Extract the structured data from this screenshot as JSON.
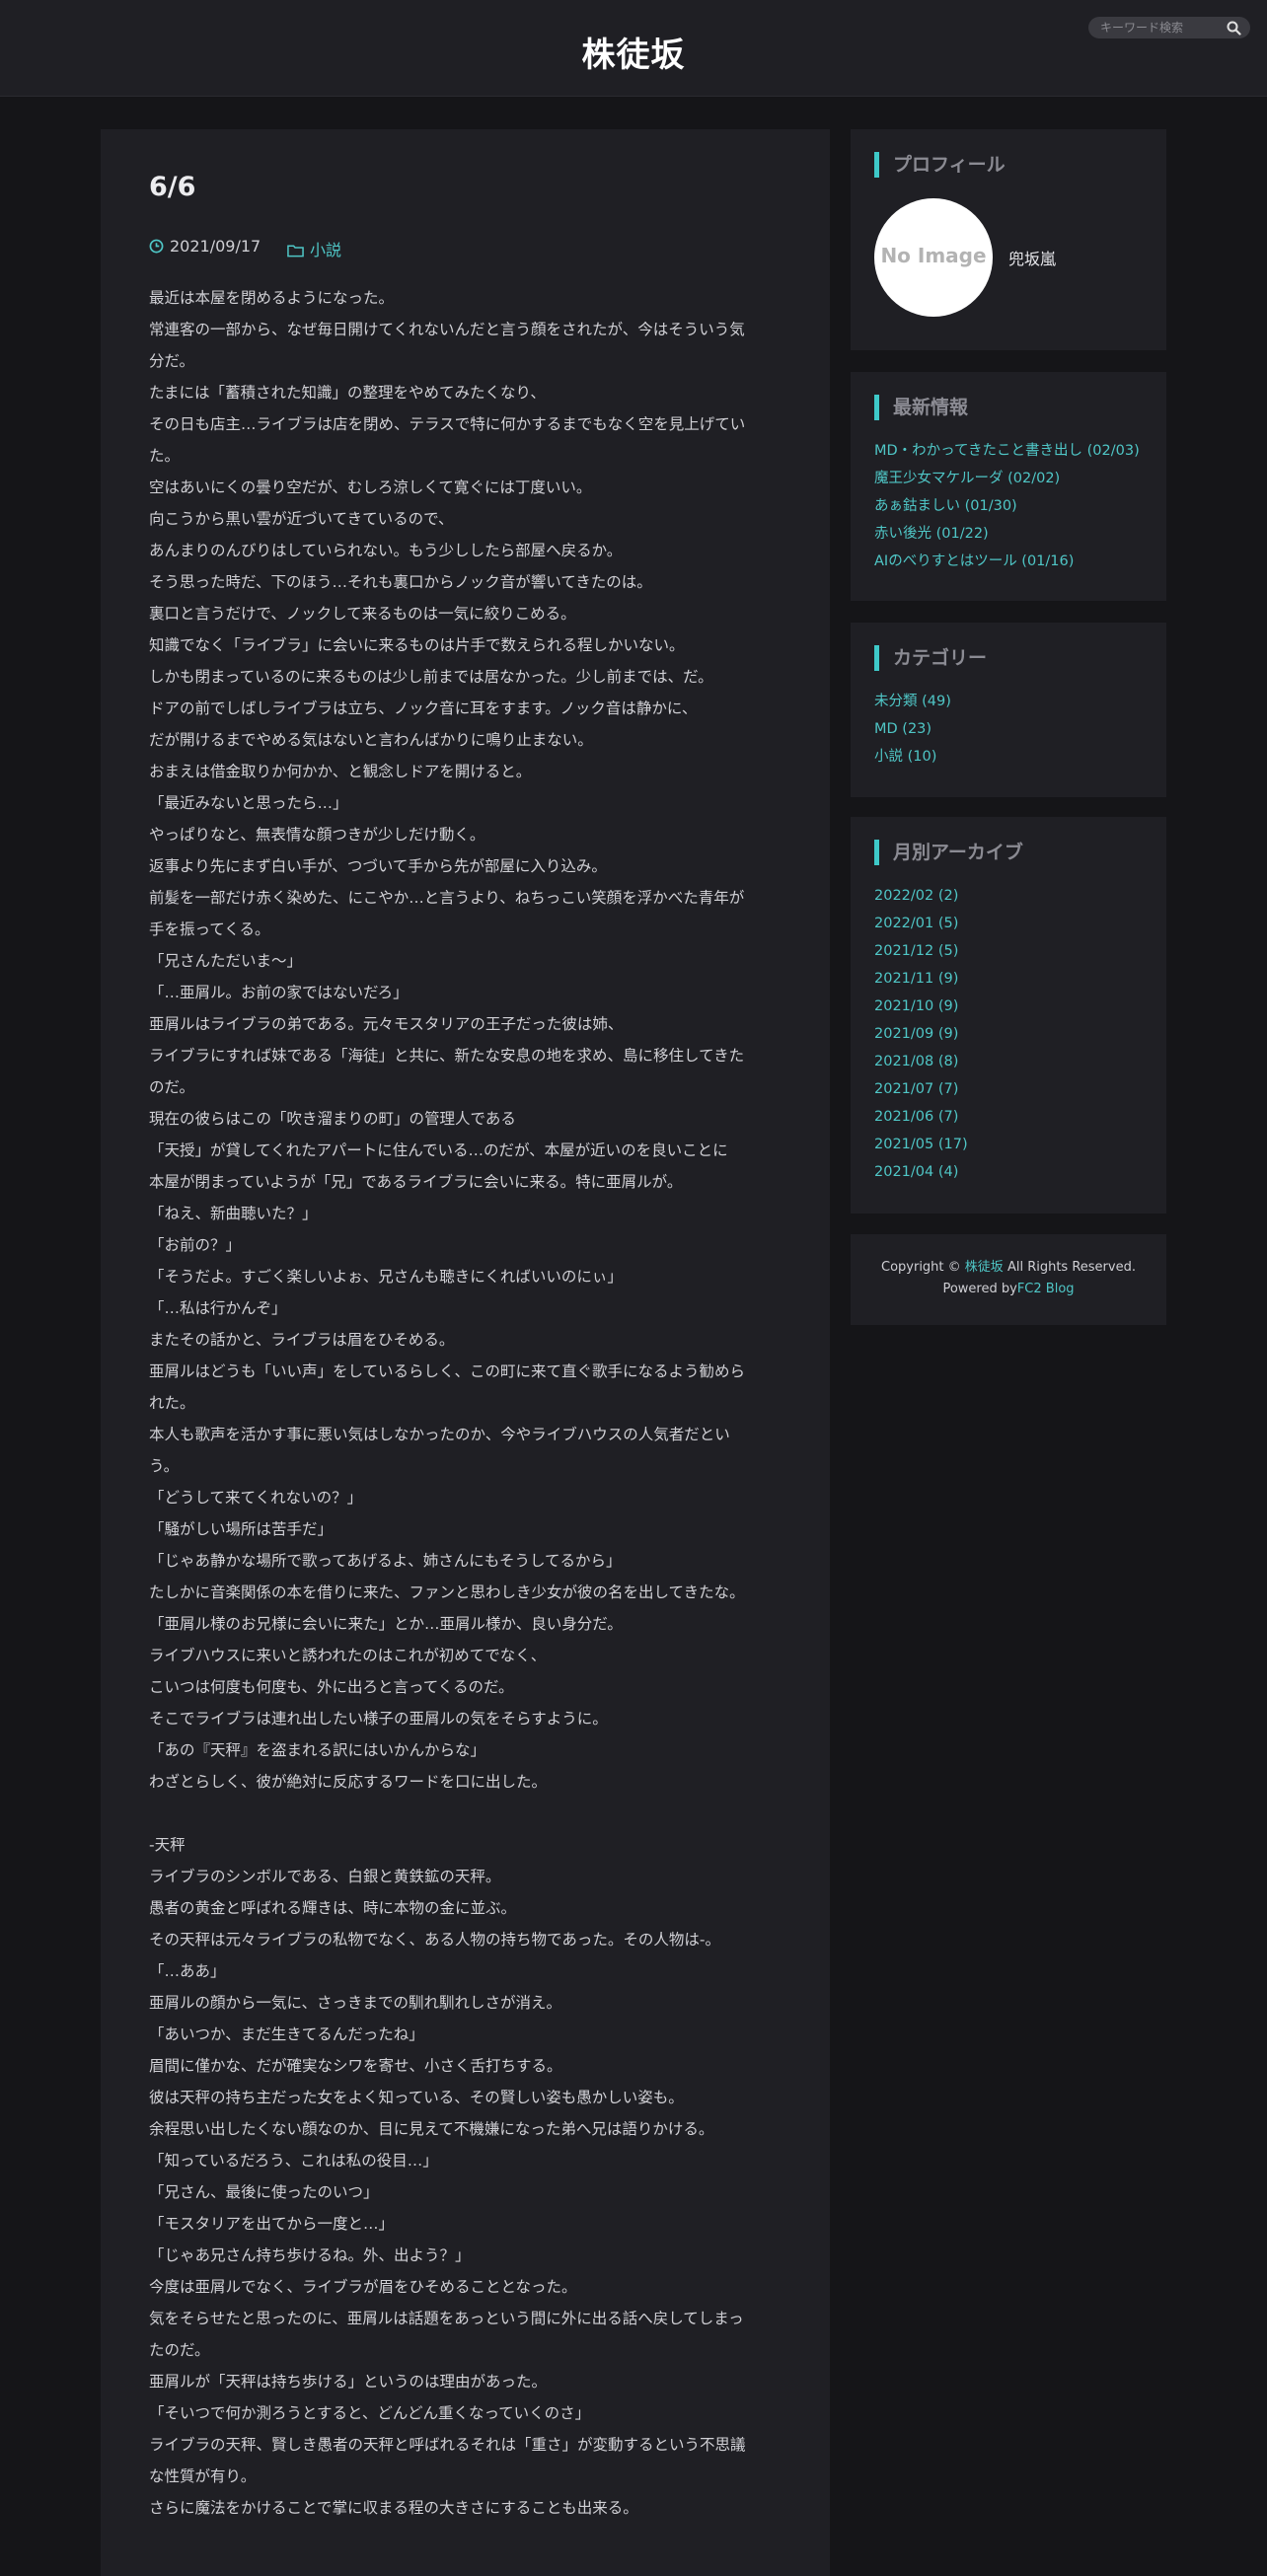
{
  "header": {
    "title": "株徒坂",
    "search_placeholder": "キーワード検索"
  },
  "post": {
    "title": "6/6",
    "date": "2021/09/17",
    "category": "小説",
    "lines": [
      "最近は本屋を閉めるようになった。",
      "常連客の一部から、なぜ毎日開けてくれないんだと言う顔をされたが、今はそういう気",
      "分だ。",
      "たまには「蓄積された知識」の整理をやめてみたくなり、",
      "その日も店主…ライブラは店を閉め、テラスで特に何かするまでもなく空を見上げてい",
      "た。",
      "空はあいにくの曇り空だが、むしろ涼しくて寛ぐには丁度いい。",
      "向こうから黒い雲が近づいてきているので、",
      "あんまりのんびりはしていられない。もう少ししたら部屋へ戻るか。",
      "そう思った時だ、下のほう…それも裏口からノック音が響いてきたのは。",
      "裏口と言うだけで、ノックして来るものは一気に絞りこめる。",
      "知識でなく「ライブラ」に会いに来るものは片手で数えられる程しかいない。",
      "しかも閉まっているのに来るものは少し前までは居なかった。少し前までは、だ。",
      "ドアの前でしばしライブラは立ち、ノック音に耳をすます。ノック音は静かに、",
      "だが開けるまでやめる気はないと言わんばかりに鳴り止まない。",
      "おまえは借金取りか何かか、と観念しドアを開けると。",
      "「最近みないと思ったら…」",
      "やっぱりなと、無表情な顔つきが少しだけ動く。",
      "返事より先にまず白い手が、つづいて手から先が部屋に入り込み。",
      "前髪を一部だけ赤く染めた、にこやか…と言うより、ねちっこい笑顔を浮かべた青年が",
      "手を振ってくる。",
      "「兄さんただいま～」",
      "「…亜屑ル。お前の家ではないだろ」",
      "亜屑ルはライブラの弟である。元々モスタリアの王子だった彼は姉、",
      "ライブラにすれば妹である「海徒」と共に、新たな安息の地を求め、島に移住してきた",
      "のだ。",
      "現在の彼らはこの「吹き溜まりの町」の管理人である",
      "「天授」が貸してくれたアパートに住んでいる…のだが、本屋が近いのを良いことに",
      "本屋が閉まっていようが「兄」であるライブラに会いに来る。特に亜屑ルが。",
      "「ねえ、新曲聴いた？」",
      "「お前の？」",
      "「そうだよ。すごく楽しいよぉ、兄さんも聴きにくればいいのにぃ」",
      "「…私は行かんぞ」",
      "またその話かと、ライブラは眉をひそめる。",
      "亜屑ルはどうも「いい声」をしているらしく、この町に来て直ぐ歌手になるよう勧めら",
      "れた。",
      "本人も歌声を活かす事に悪い気はしなかったのか、今やライブハウスの人気者だとい",
      "う。",
      "「どうして来てくれないの？」",
      "「騒がしい場所は苦手だ」",
      "「じゃあ静かな場所で歌ってあげるよ、姉さんにもそうしてるから」",
      "たしかに音楽関係の本を借りに来た、ファンと思わしき少女が彼の名を出してきたな。",
      "「亜屑ル様のお兄様に会いに来た」とか…亜屑ル様か、良い身分だ。",
      "ライブハウスに来いと誘われたのはこれが初めてでなく、",
      "こいつは何度も何度も、外に出ろと言ってくるのだ。",
      "そこでライブラは連れ出したい様子の亜屑ルの気をそらすように。",
      "「あの『天秤』を盗まれる訳にはいかんからな」",
      "わざとらしく、彼が絶対に反応するワードを口に出した。",
      "",
      "-天秤",
      "ライブラのシンボルである、白銀と黄鉄鉱の天秤。",
      "愚者の黄金と呼ばれる輝きは、時に本物の金に並ぶ。",
      "その天秤は元々ライブラの私物でなく、ある人物の持ち物であった。その人物は-。",
      "「…ああ」",
      "亜屑ルの顔から一気に、さっきまでの馴れ馴れしさが消え。",
      "「あいつか、まだ生きてるんだったね」",
      "眉間に僅かな、だが確実なシワを寄せ、小さく舌打ちする。",
      "彼は天秤の持ち主だった女をよく知っている、その賢しい姿も愚かしい姿も。",
      "余程思い出したくない顔なのか、目に見えて不機嫌になった弟へ兄は語りかける。",
      "「知っているだろう、これは私の役目…」",
      "「兄さん、最後に使ったのいつ」",
      "「モスタリアを出てから一度と…」",
      "「じゃあ兄さん持ち歩けるね。外、出よう？」",
      "今度は亜屑ルでなく、ライブラが眉をひそめることとなった。",
      "気をそらせたと思ったのに、亜屑ルは話題をあっという間に外に出る話へ戻してしまっ",
      "たのだ。",
      "亜屑ルが「天秤は持ち歩ける」というのは理由があった。",
      "「そいつで何か測ろうとすると、どんどん重くなっていくのさ」",
      "ライブラの天秤、賢しき愚者の天秤と呼ばれるそれは「重さ」が変動するという不思議",
      "な性質が有り。",
      "さらに魔法をかけることで掌に収まる程の大きさにすることも出来る。"
    ]
  },
  "sidebar": {
    "profile": {
      "title": "プロフィール",
      "avatar_text": "No Image",
      "name": "兜坂嵐"
    },
    "recent": {
      "title": "最新情報",
      "items": [
        "MD・わかってきたこと書き出し (02/03)",
        "魔王少女マケルーダ (02/02)",
        "あぁ鈷ましい (01/30)",
        "赤い後光 (01/22)",
        "AIのべりすとはツール (01/16)"
      ]
    },
    "categories": {
      "title": "カテゴリー",
      "items": [
        "未分類 (49)",
        "MD (23)",
        "小説 (10)"
      ]
    },
    "archive": {
      "title": "月別アーカイブ",
      "items": [
        "2022/02 (2)",
        "2022/01 (5)",
        "2021/12 (5)",
        "2021/11 (9)",
        "2021/10 (9)",
        "2021/09 (9)",
        "2021/08 (8)",
        "2021/07 (7)",
        "2021/06 (7)",
        "2021/05 (17)",
        "2021/04 (4)"
      ]
    },
    "footer": {
      "copyright_prefix": "Copyright ©",
      "site_link": "株徒坂",
      "rights": "All Rights Reserved.",
      "powered_prefix": "Powered by",
      "powered_link": "FC2 Blog"
    }
  },
  "colors": {
    "background": "#151518",
    "panel": "#1f1f24",
    "accent": "#4fc6c6",
    "widget_bar": "#3ec9c9"
  }
}
